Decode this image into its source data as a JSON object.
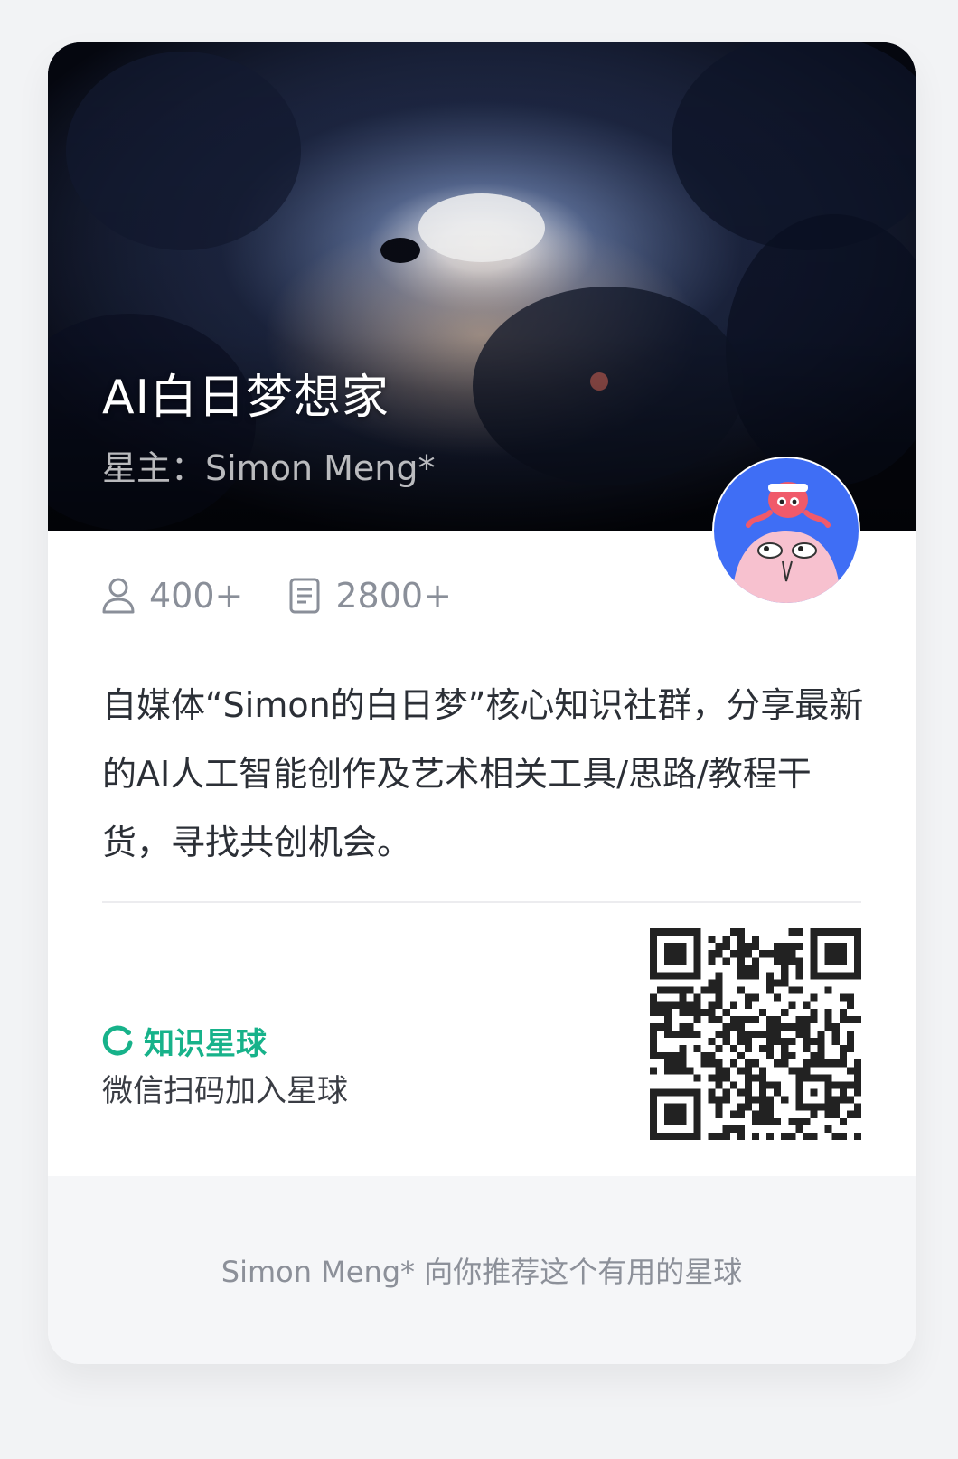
{
  "planet": {
    "title": "AI白日梦想家",
    "owner_label": "星主：Simon Meng*"
  },
  "stats": {
    "members": "400+",
    "posts": "2800+"
  },
  "description": "自媒体“Simon的白日梦”核心知识社群，分享最新的AI人工智能创作及艺术相关工具/思路/教程干货，寻找共创机会。",
  "brand": {
    "name": "知识星球",
    "color": "#17b28a"
  },
  "scan": {
    "text": "微信扫码加入星球"
  },
  "footer": {
    "text": "Simon Meng* 向你推荐这个有用的星球"
  },
  "icons": {
    "members": "person-icon",
    "posts": "document-icon",
    "brand": "zsxq-logo-icon",
    "avatar": "octopus-avatar"
  }
}
